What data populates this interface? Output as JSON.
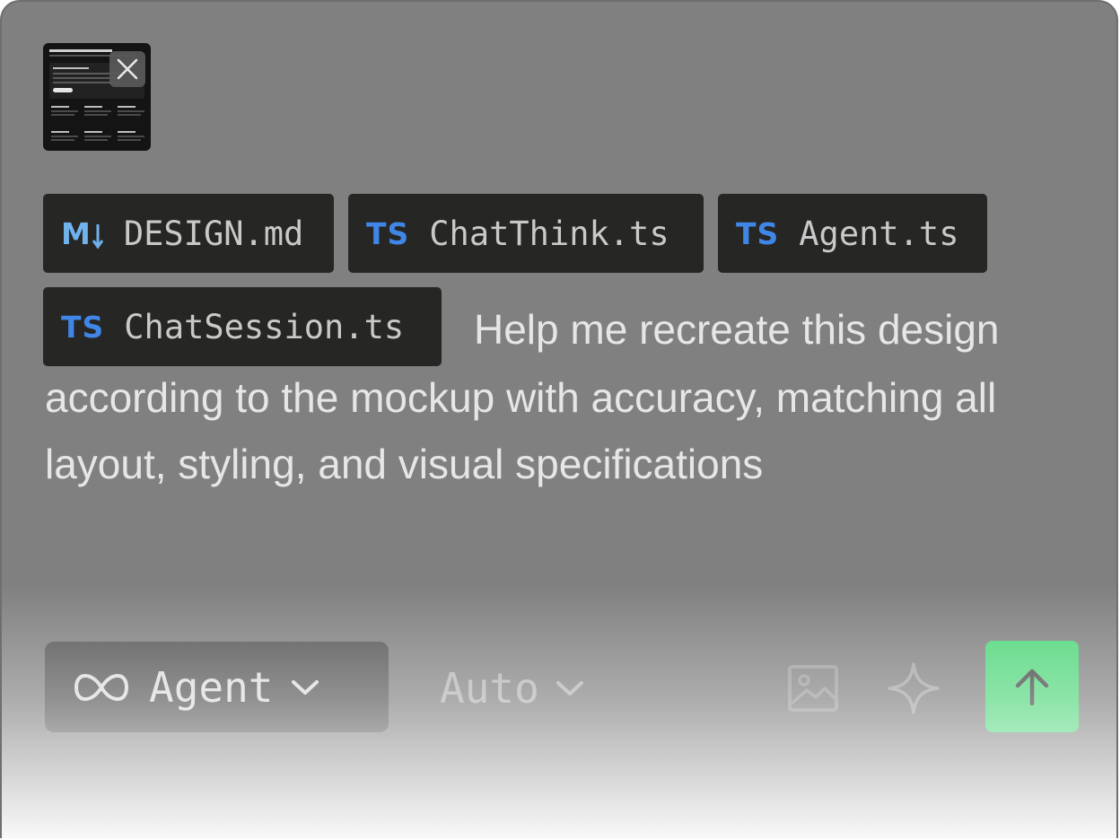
{
  "attachment": {
    "close_icon": "close-icon"
  },
  "files": [
    {
      "icon": "M",
      "name": "DESIGN.md",
      "type": "markdown"
    },
    {
      "icon": "TS",
      "name": "ChatThink.ts",
      "type": "typescript"
    },
    {
      "icon": "TS",
      "name": "Agent.ts",
      "type": "typescript"
    },
    {
      "icon": "TS",
      "name": "ChatSession.ts",
      "type": "typescript"
    }
  ],
  "prompt": {
    "line1": "Help me recreate this design",
    "rest": "according to the mockup with accuracy, matching all layout, styling, and visual specifications"
  },
  "toolbar": {
    "mode_label": "Agent",
    "model_label": "Auto",
    "icons": [
      "infinity-icon",
      "chevron-down-icon",
      "image-icon",
      "sparkle-icon",
      "arrow-up-icon"
    ]
  },
  "colors": {
    "panel_bg": "#808080",
    "chip_bg": "#262624",
    "ts_blue": "#3f86e6",
    "md_blue": "#6fb2ec",
    "send_green": "#4fd67a"
  }
}
